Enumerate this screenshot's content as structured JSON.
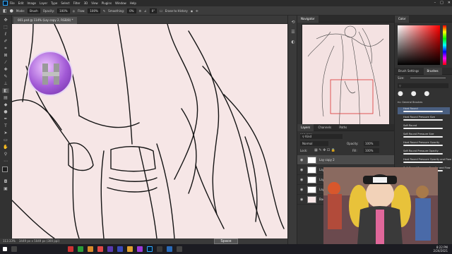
{
  "menubar": {
    "items": [
      "File",
      "Edit",
      "Image",
      "Layer",
      "Type",
      "Select",
      "Filter",
      "3D",
      "View",
      "Plugins",
      "Window",
      "Help"
    ]
  },
  "optbar": {
    "mode_label": "Mode:",
    "mode_value": "Brush",
    "opacity_label": "Opacity:",
    "opacity_value": "100%",
    "flow_label": "Flow:",
    "flow_value": "100%",
    "smoothing_label": "Smoothing:",
    "smoothing_value": "0%",
    "angle_value": "0°",
    "erase_history_label": "Erase to History"
  },
  "document": {
    "tab_label": "001.psd @ 114% (Lay copy 2, RGB/8) *",
    "zoom_status": "113.33%",
    "size_status": "3449 px x 5049 px (300 ppi)"
  },
  "navigator": {
    "tabs": [
      "Navigator"
    ],
    "zoom": "113.33%"
  },
  "layers": {
    "tabs": [
      "Layers",
      "Channels",
      "Paths"
    ],
    "search_placeholder": "Kind",
    "blend_mode": "Normal",
    "opacity_label": "Opacity:",
    "opacity_value": "100%",
    "lock_label": "Lock:",
    "fill_label": "Fill:",
    "fill_value": "100%",
    "rows": [
      "Lay copy 2",
      "Layer 1",
      "Layer 2",
      "Layer 3",
      "Background"
    ]
  },
  "color": {
    "tabs": [
      "Color"
    ],
    "foreground": "#1e1e1e"
  },
  "brushes": {
    "tabs": [
      "Brush Settings",
      "Brushes"
    ],
    "size_label": "Size:",
    "group_label": "General Brushes",
    "items": [
      "Hard Round",
      "Hard Round Pressure Size",
      "Soft Round",
      "Soft Round Pressure Size",
      "Hard Round Pressure Opacity",
      "Soft Round Pressure Opacity",
      "Hard Round Pressure Opacity and Flow",
      "Soft Round Pressure Opacity and Flow",
      "Dry Media Brushes",
      "Wet Media Brushes",
      "Special Effects Brushes",
      "Brush set Fan Art 2020",
      "HB Starter Pack 2020 4",
      "Brush set Fan Art 2020 1"
    ]
  },
  "overlay": {
    "space_key": "Space"
  },
  "taskbar": {
    "time": "8:22 PM",
    "date": "2/24/2021"
  },
  "icons": [
    "photoshop-icon",
    "move-icon",
    "marquee-icon",
    "lasso-icon",
    "quick-select-icon",
    "crop-icon",
    "eyedropper-icon",
    "healing-icon",
    "brush-icon",
    "stamp-icon",
    "history-brush-icon",
    "eraser-icon",
    "gradient-icon",
    "blur-icon",
    "dodge-icon",
    "pen-icon",
    "type-icon",
    "path-select-icon",
    "shape-icon",
    "hand-icon",
    "zoom-icon"
  ]
}
